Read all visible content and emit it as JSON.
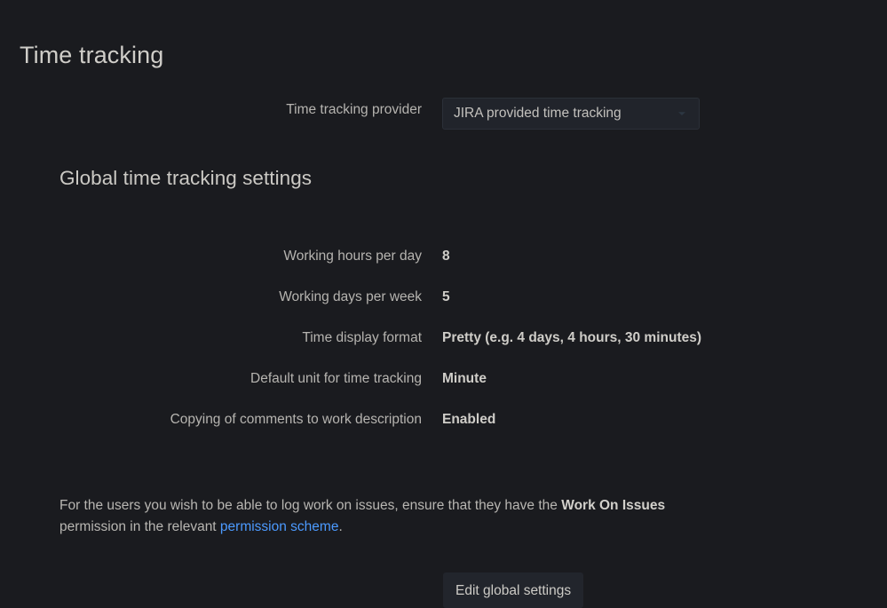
{
  "page": {
    "title": "Time tracking"
  },
  "provider": {
    "label": "Time tracking provider",
    "selected": "JIRA provided time tracking",
    "icon": "chevron-down-icon"
  },
  "global_settings": {
    "heading": "Global time tracking settings",
    "rows": [
      {
        "label": "Working hours per day",
        "value": "8"
      },
      {
        "label": "Working days per week",
        "value": "5"
      },
      {
        "label": "Time display format",
        "value": "Pretty (e.g. 4 days, 4 hours, 30 minutes)"
      },
      {
        "label": "Default unit for time tracking",
        "value": "Minute"
      },
      {
        "label": "Copying of comments to work description",
        "value": "Enabled"
      }
    ]
  },
  "note": {
    "text_before_bold": "For the users you wish to be able to log work on issues, ensure that they have the ",
    "bold_text": "Work On Issues",
    "text_between": " permission in the relevant ",
    "link_text": "permission scheme",
    "text_after": "."
  },
  "footer": {
    "edit_button_label": "Edit global settings"
  },
  "colors": {
    "background": "#1a1b1f",
    "text": "#b6b4b0",
    "value_text": "#cfcdc8",
    "link": "#4c9aff",
    "field_background": "#21242b",
    "field_border": "#2b3038",
    "button_background": "#22252c"
  }
}
